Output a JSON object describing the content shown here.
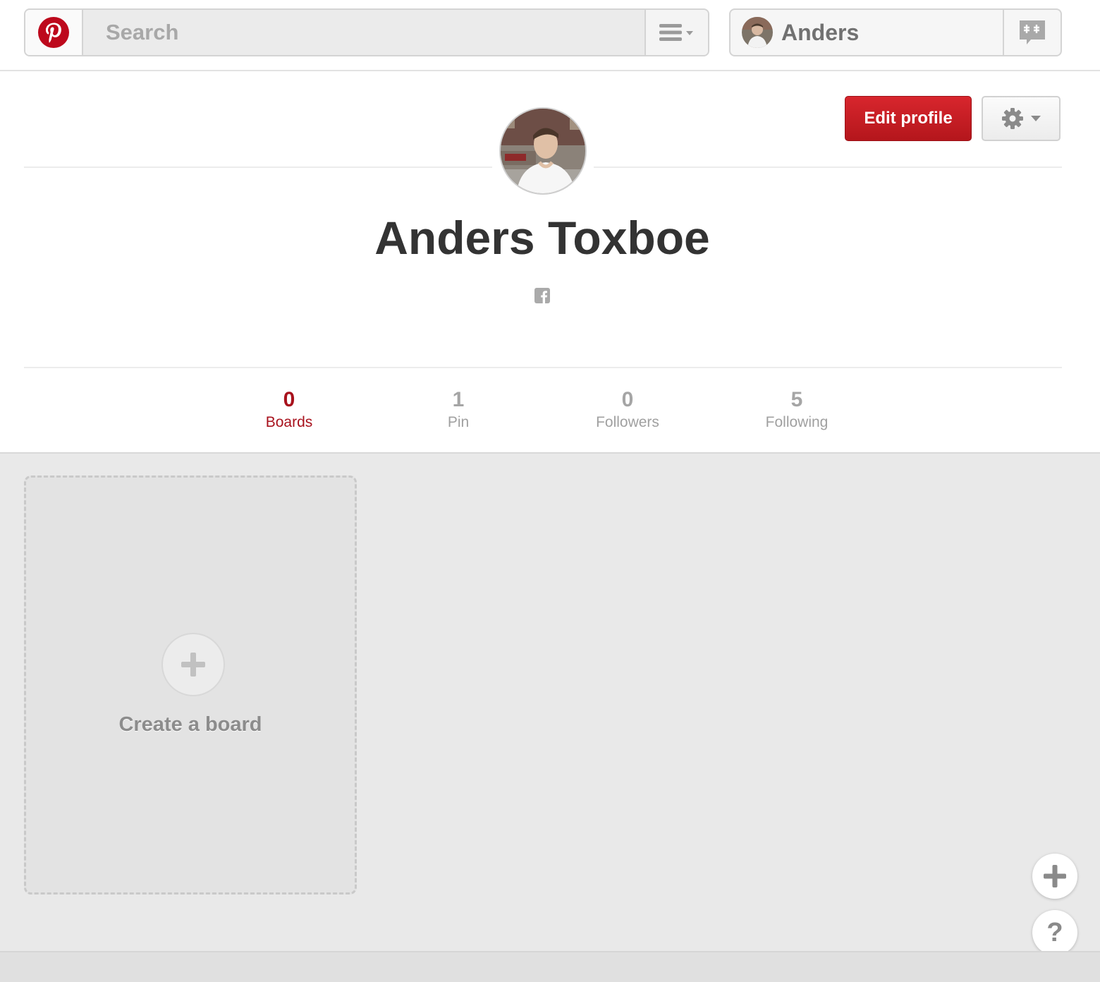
{
  "header": {
    "search_placeholder": "Search",
    "username": "Anders",
    "brand_color": "#bd081c"
  },
  "profile": {
    "full_name": "Anders Toxboe",
    "edit_profile_label": "Edit profile",
    "social_icon": "facebook-icon"
  },
  "stats": [
    {
      "count": "0",
      "label": "Boards",
      "active": true
    },
    {
      "count": "1",
      "label": "Pin",
      "active": false
    },
    {
      "count": "0",
      "label": "Followers",
      "active": false
    },
    {
      "count": "5",
      "label": "Following",
      "active": false
    }
  ],
  "boards": {
    "create_label": "Create a board"
  },
  "floating": {
    "help_label": "?"
  },
  "colors": {
    "accent_red": "#b4161c",
    "active_stat": "#a8121d",
    "muted_text": "#a0a0a0"
  }
}
